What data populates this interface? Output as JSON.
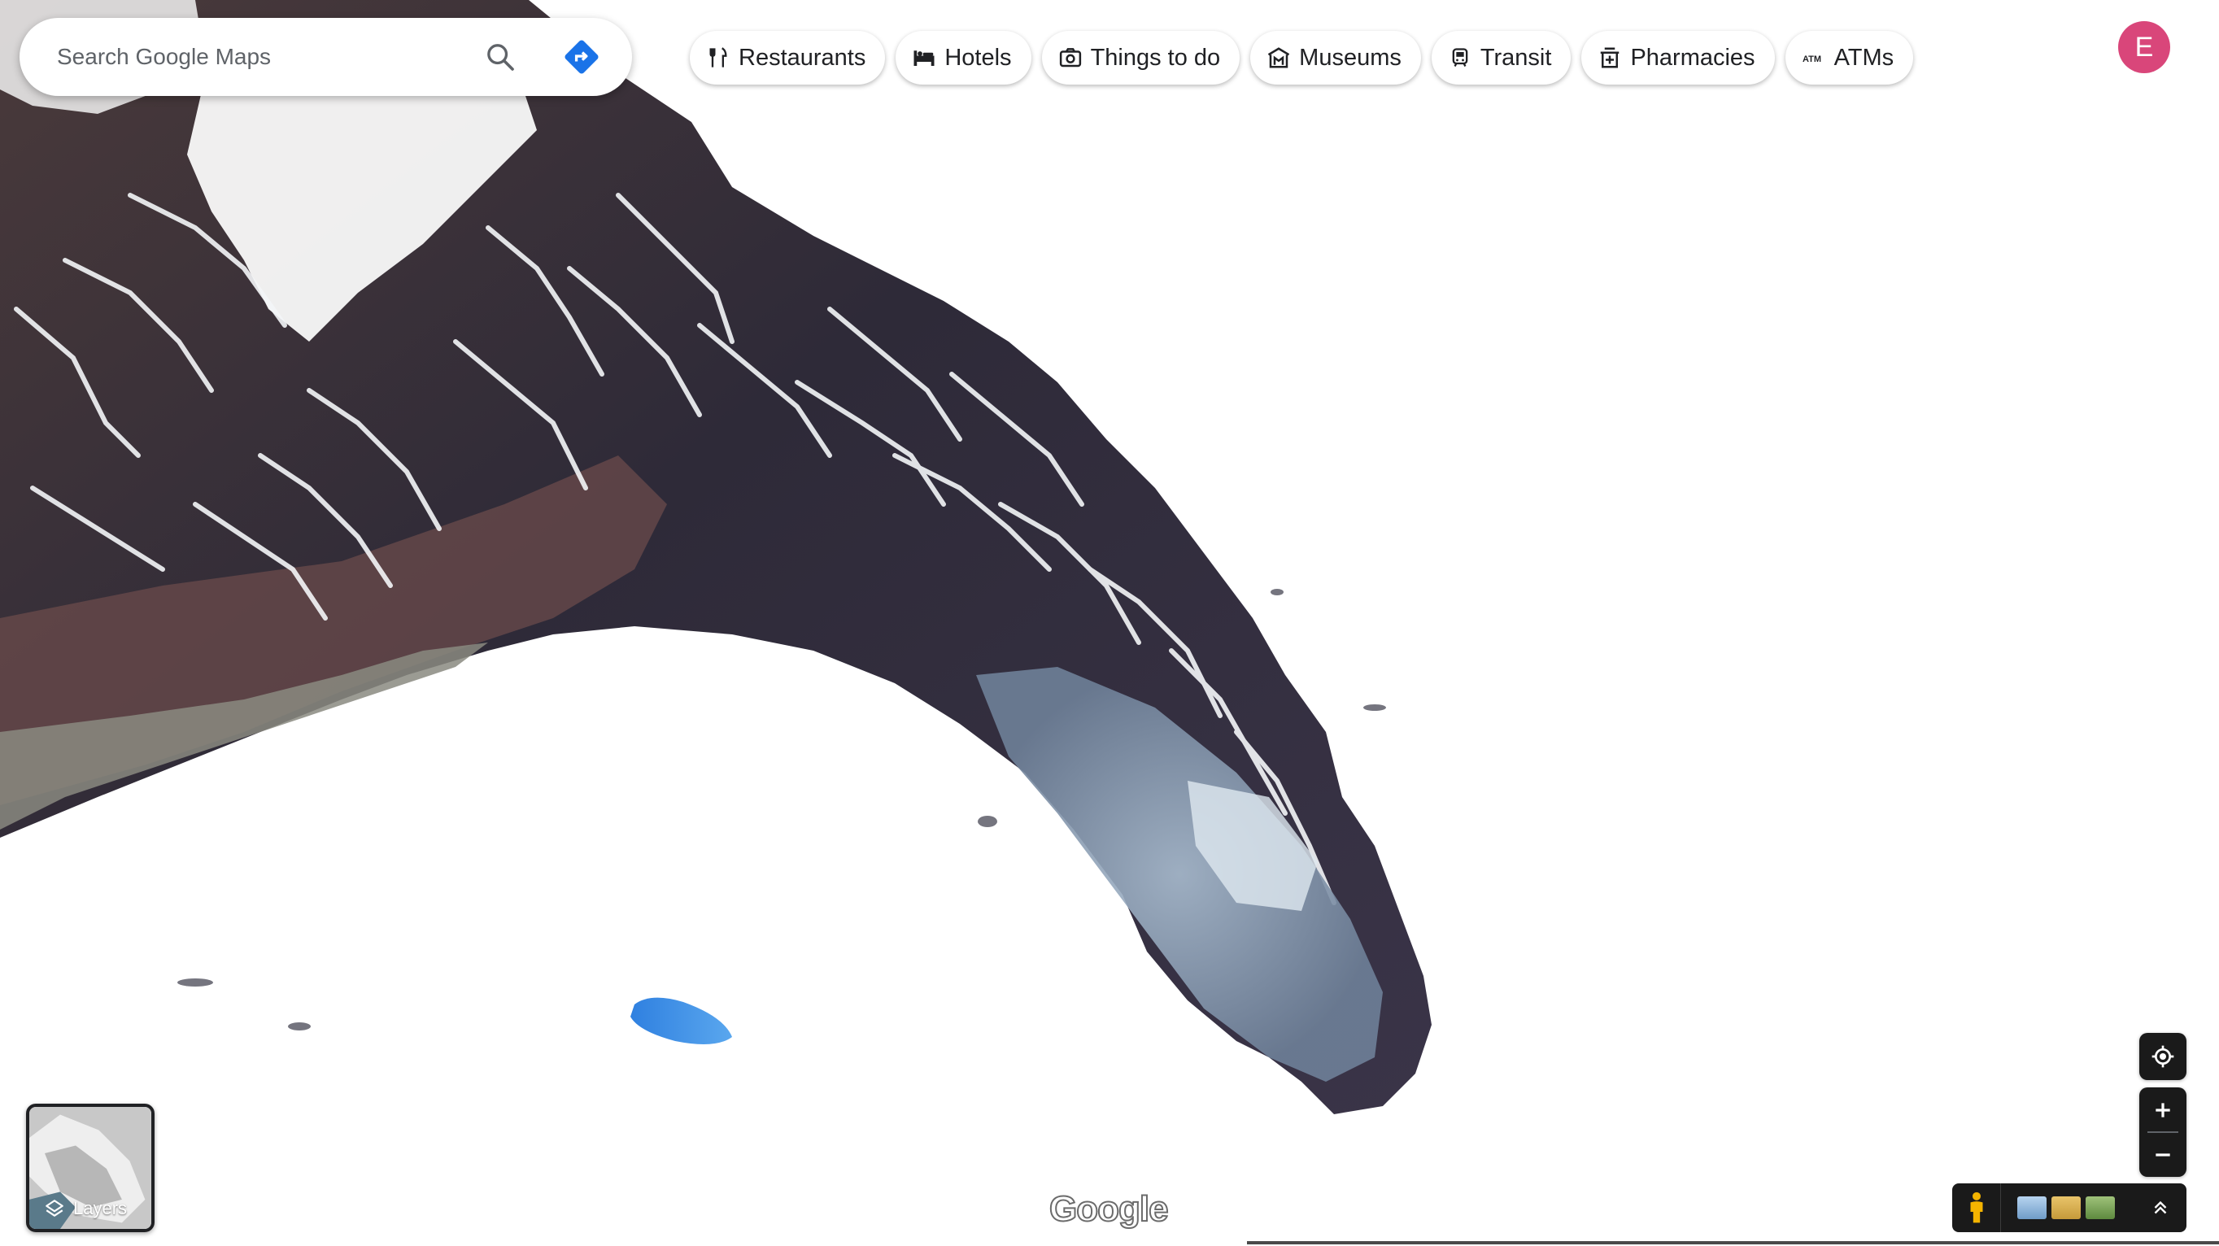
{
  "search": {
    "placeholder": "Search Google Maps",
    "search_icon": "search-icon",
    "directions_icon": "directions-icon"
  },
  "chips": [
    {
      "label": "Restaurants",
      "icon": "fork-knife-icon"
    },
    {
      "label": "Hotels",
      "icon": "bed-icon"
    },
    {
      "label": "Things to do",
      "icon": "camera-icon"
    },
    {
      "label": "Museums",
      "icon": "museum-icon"
    },
    {
      "label": "Transit",
      "icon": "train-icon"
    },
    {
      "label": "Pharmacies",
      "icon": "pharmacy-icon"
    },
    {
      "label": "ATMs",
      "icon": "atm-icon"
    }
  ],
  "account": {
    "initial": "E",
    "color": "#d9467a"
  },
  "layers": {
    "label": "Layers",
    "icon": "layers-icon"
  },
  "branding": {
    "logo_text": "Google"
  },
  "map_controls": {
    "locate_icon": "my-location-icon",
    "zoom_in_icon": "plus-icon",
    "zoom_out_icon": "minus-icon",
    "pegman_icon": "pegman-icon",
    "expand_icon": "chevron-up-icon"
  },
  "colors": {
    "directions_blue": "#1a73e8",
    "pegman_yellow": "#f4b400",
    "lake_blue": "#3a8ee6"
  }
}
